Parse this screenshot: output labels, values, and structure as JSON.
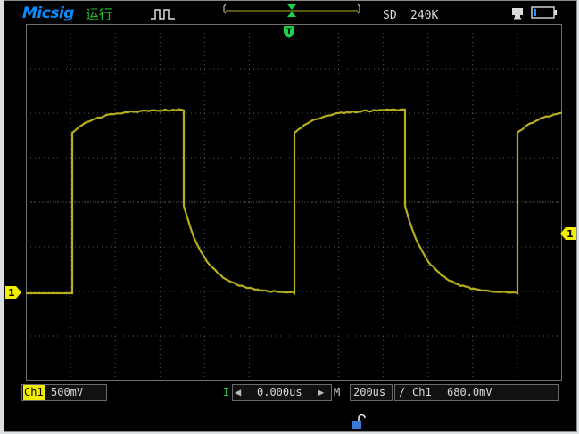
{
  "header": {
    "brand": "Micsig",
    "run_state": "运行",
    "acquire_mode": "SD",
    "memory_depth": "240K",
    "trigger_marker_label": "T"
  },
  "channel1": {
    "marker": "1",
    "trigger_level_marker": "1",
    "name": "Ch1",
    "scale": "500mV"
  },
  "timebase": {
    "position_label": "I",
    "position": "0.000us",
    "mode": "M",
    "scale": "200us"
  },
  "trigger": {
    "slope_symbol": "/",
    "source": "Ch1",
    "level": "680.0mV"
  },
  "colors": {
    "trace": "#b5ad1c",
    "ch1_badge": "#f2ee00",
    "grid": "#5a5a5a",
    "trigger_marker": "#1fd04a",
    "brand": "#0a8cff"
  },
  "icons": {
    "waveform_icon": "square-pulse",
    "usb_icon": "usb-drive",
    "battery_icon": "battery",
    "lock_icon": "unlocked-padlock"
  }
}
